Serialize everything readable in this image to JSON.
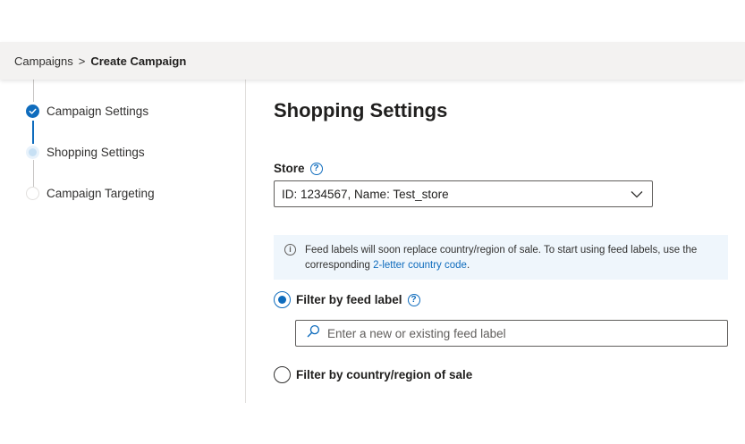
{
  "breadcrumb": {
    "parent": "Campaigns",
    "separator": ">",
    "current": "Create Campaign"
  },
  "stepper": {
    "steps": [
      {
        "label": "Campaign Settings",
        "state": "done"
      },
      {
        "label": "Shopping Settings",
        "state": "current"
      },
      {
        "label": "Campaign Targeting",
        "state": "pending"
      }
    ]
  },
  "main": {
    "title": "Shopping Settings",
    "store": {
      "label": "Store",
      "help_glyph": "?",
      "selected": "ID: 1234567, Name: Test_store"
    },
    "info": {
      "icon_glyph": "i",
      "text": "Feed labels will soon replace country/region of sale. To start using feed labels, use the corresponding",
      "link": "2-letter country code",
      "suffix": "."
    },
    "filter_feed_label": {
      "label": "Filter by feed label",
      "help_glyph": "?",
      "checked": true,
      "input_value": "",
      "input_placeholder": "Enter a new or existing feed label"
    },
    "filter_country": {
      "label": "Filter by country/region of sale",
      "checked": false
    }
  },
  "colors": {
    "accent": "#0f6cbd",
    "breadcrumb_bg": "#f3f2f1",
    "info_bg": "#eff6fc"
  }
}
